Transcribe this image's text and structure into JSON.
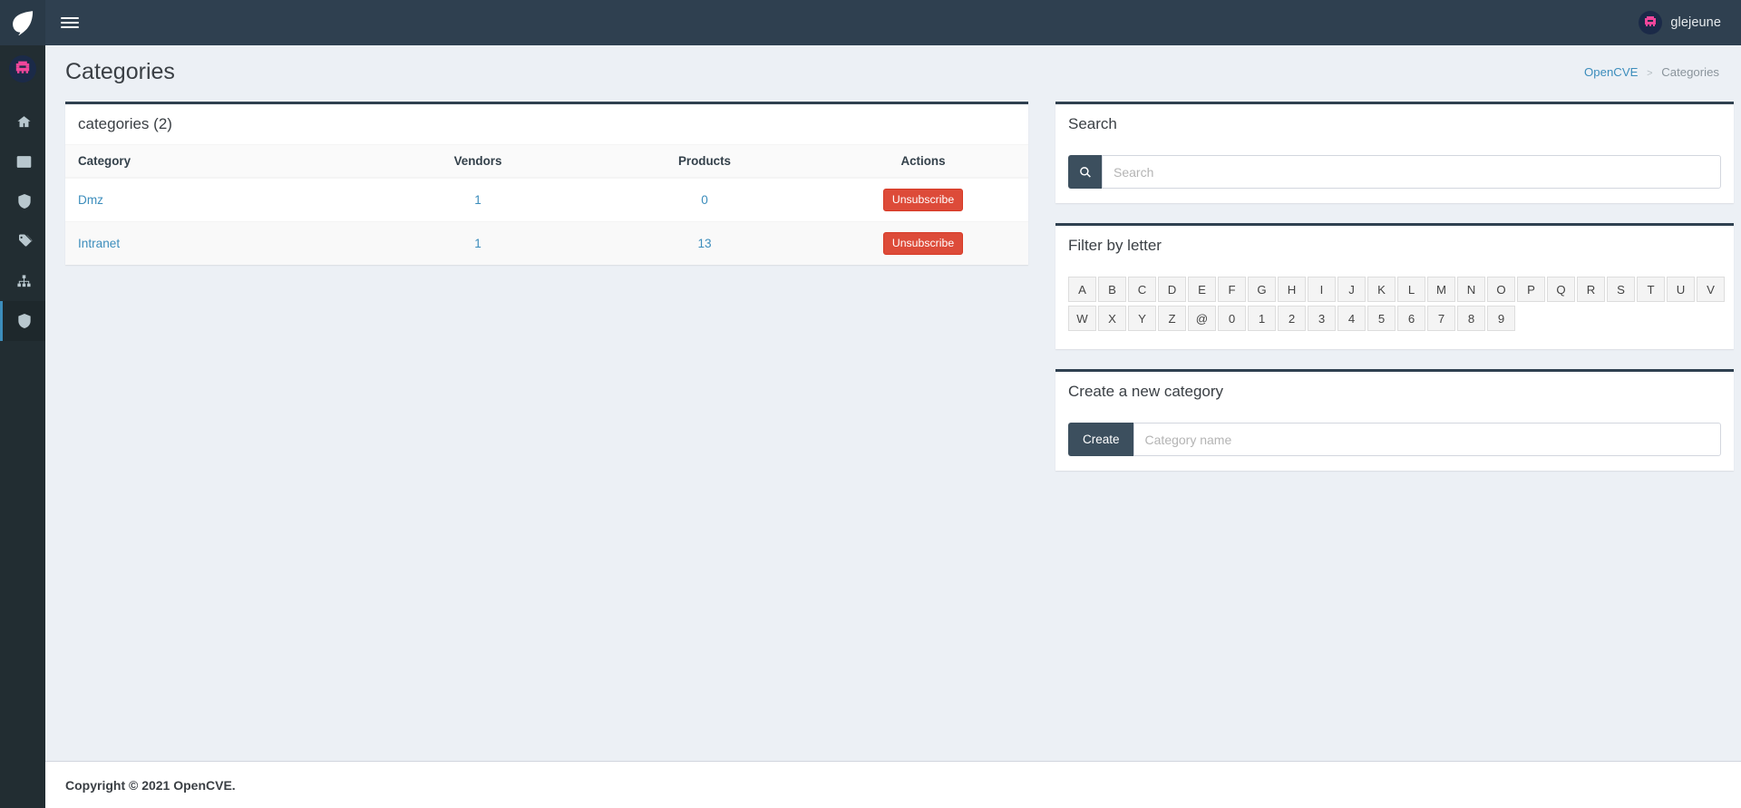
{
  "topbar": {
    "logo_icon": "shield-leaf-logo",
    "menu_toggle_label": "Toggle navigation",
    "user_name": "glejeune",
    "avatar_icon": "space-invader-avatar"
  },
  "sidebar": {
    "avatar_icon": "space-invader-avatar",
    "items": [
      {
        "name": "home",
        "icon": "home-icon",
        "label": "Home",
        "active": false
      },
      {
        "name": "cves",
        "icon": "list-icon",
        "label": "CVEs",
        "active": false
      },
      {
        "name": "vendors",
        "icon": "shield-icon",
        "label": "Vendors",
        "active": false
      },
      {
        "name": "tags",
        "icon": "tags-icon",
        "label": "Tags",
        "active": false
      },
      {
        "name": "organizations",
        "icon": "sitemap-icon",
        "label": "Organizations",
        "active": false
      },
      {
        "name": "categories",
        "icon": "shield-icon",
        "label": "Categories",
        "active": true
      }
    ]
  },
  "page": {
    "title": "Categories",
    "breadcrumb": {
      "root": "OpenCVE",
      "separator": ">",
      "current": "Categories"
    }
  },
  "categories_box": {
    "title": "categories (2)",
    "columns": [
      "Category",
      "Vendors",
      "Products",
      "Actions"
    ],
    "rows": [
      {
        "category": "Dmz",
        "vendors": "1",
        "products": "0",
        "action_label": "Unsubscribe"
      },
      {
        "category": "Intranet",
        "vendors": "1",
        "products": "13",
        "action_label": "Unsubscribe"
      }
    ]
  },
  "search_box": {
    "title": "Search",
    "search_icon": "search-icon",
    "input_value": "",
    "placeholder": "Search"
  },
  "filter_box": {
    "title": "Filter by letter",
    "row1": [
      "A",
      "B",
      "C",
      "D",
      "E",
      "F",
      "G",
      "H",
      "I",
      "J",
      "K",
      "L",
      "M",
      "N",
      "O",
      "P",
      "Q",
      "R",
      "S",
      "T",
      "U",
      "V"
    ],
    "row2": [
      "W",
      "X",
      "Y",
      "Z",
      "@",
      "0",
      "1",
      "2",
      "3",
      "4",
      "5",
      "6",
      "7",
      "8",
      "9"
    ]
  },
  "create_box": {
    "title": "Create a new category",
    "button_label": "Create",
    "input_value": "",
    "placeholder": "Category name"
  },
  "footer": {
    "text": "Copyright © 2021 OpenCVE."
  },
  "colors": {
    "topbar": "#2f4050",
    "sidebar": "#222d32",
    "active_accent": "#3c8dbc",
    "danger": "#dd4b39",
    "link": "#3c8dbc",
    "page_bg": "#ecf0f5",
    "avatar_pink": "#f0469b"
  }
}
